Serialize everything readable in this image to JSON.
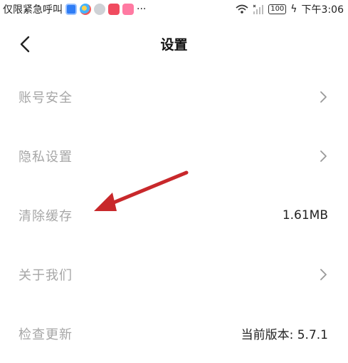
{
  "status_bar": {
    "carrier_text": "仅限紧急呼叫",
    "more": "···",
    "battery": "100",
    "time": "下午3:06",
    "app_icons": [
      "blue-app-icon",
      "multicolor-app-icon",
      "wechat-icon",
      "red-app-icon",
      "pink-app-icon"
    ]
  },
  "header": {
    "title": "设置",
    "back_icon": "back-arrow-icon"
  },
  "settings": {
    "items": [
      {
        "label": "账号安全",
        "value": "",
        "trailing": "chevron-right-icon"
      },
      {
        "label": "隐私设置",
        "value": "",
        "trailing": "chevron-right-icon"
      },
      {
        "label": "清除缓存",
        "value": "1.61MB",
        "trailing": ""
      },
      {
        "label": "关于我们",
        "value": "",
        "trailing": "chevron-right-icon"
      },
      {
        "label": "检查更新",
        "value": "当前版本: 5.7.1",
        "trailing": ""
      }
    ]
  },
  "colors": {
    "label_gray": "#a6a6a6",
    "annotation_red": "#c8282b"
  }
}
